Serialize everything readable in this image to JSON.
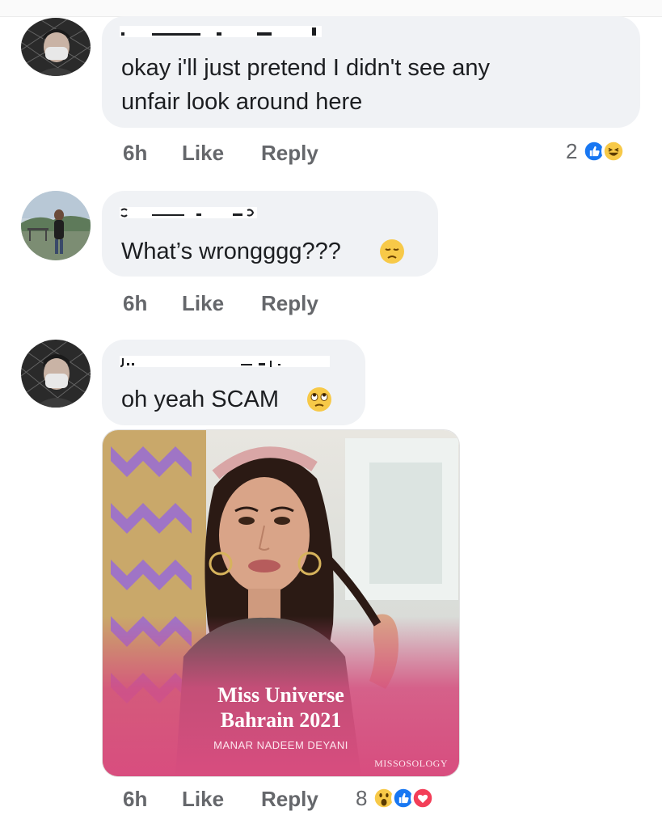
{
  "comments": [
    {
      "text_line1": "okay i'll just pretend I didn't see any",
      "text_line2": "unfair look around here",
      "time": "6h",
      "like_label": "Like",
      "reply_label": "Reply",
      "reaction_count": "2",
      "reaction_icons": [
        "like-icon",
        "laugh-icon"
      ]
    },
    {
      "text_line1": "What’s wrongggg???",
      "text_line2": "",
      "emoji": "sad-face-emoji",
      "time": "6h",
      "like_label": "Like",
      "reply_label": "Reply"
    },
    {
      "text_line1": "oh yeah SCAM",
      "text_line2": "",
      "emoji": "eye-roll-emoji",
      "time": "6h",
      "like_label": "Like",
      "reply_label": "Reply",
      "reaction_count": "8",
      "reaction_icons": [
        "wow-icon",
        "like-icon",
        "love-icon"
      ],
      "attachment": {
        "title_line1": "Miss Universe",
        "title_line2": "Bahrain 2021",
        "subtitle": "MANAR NADEEM DEYANI",
        "brand": "MISSOSOLOGY"
      }
    }
  ],
  "colors": {
    "bubble": "#f0f2f5",
    "text": "#1c1e21",
    "meta": "#65676b",
    "like_blue": "#1877f2",
    "love_red": "#f33e58",
    "emoji_yellow": "#f7c948",
    "card_pink": "#d64d7e"
  }
}
